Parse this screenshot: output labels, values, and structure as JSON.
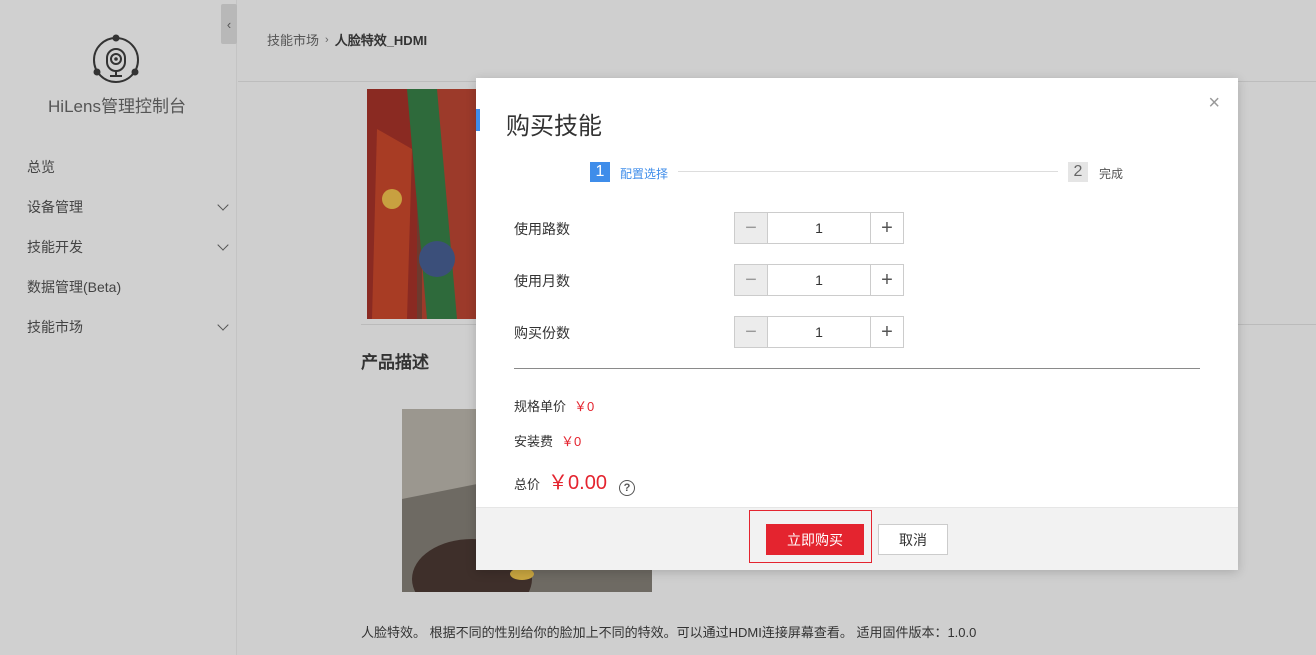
{
  "sidebar": {
    "collapse_icon": "chevron-left-icon",
    "app_title": "HiLens管理控制台",
    "items": [
      {
        "label": "总览",
        "expandable": false
      },
      {
        "label": "设备管理",
        "expandable": true
      },
      {
        "label": "技能开发",
        "expandable": true
      },
      {
        "label": "数据管理(Beta)",
        "expandable": false
      },
      {
        "label": "技能市场",
        "expandable": true
      }
    ]
  },
  "breadcrumb": {
    "parent": "技能市场",
    "separator": "›",
    "current": "人脸特效_HDMI"
  },
  "content": {
    "section_title": "产品描述",
    "description": "人脸特效。 根据不同的性别给你的脸加上不同的特效。可以通过HDMI连接屏幕查看。 适用固件版本：1.0.0"
  },
  "modal": {
    "title": "购买技能",
    "close_label": "×",
    "steps": [
      {
        "number": "1",
        "label": "配置选择",
        "active": true
      },
      {
        "number": "2",
        "label": "完成",
        "active": false
      }
    ],
    "fields": [
      {
        "label": "使用路数",
        "value": "1",
        "minus": "−",
        "plus": "+"
      },
      {
        "label": "使用月数",
        "value": "1",
        "minus": "−",
        "plus": "+"
      },
      {
        "label": "购买份数",
        "value": "1",
        "minus": "−",
        "plus": "+"
      }
    ],
    "unit_price_label": "规格单价",
    "unit_price_value": "￥0",
    "install_fee_label": "安装费",
    "install_fee_value": "￥0",
    "total_label": "总价",
    "total_value": "￥0.00",
    "help_glyph": "?",
    "buy_label": "立即购买",
    "cancel_label": "取消"
  },
  "colors": {
    "accent": "#3f8dea",
    "price_red": "#e4242f",
    "overlay_gray": "#cfcfcf"
  }
}
